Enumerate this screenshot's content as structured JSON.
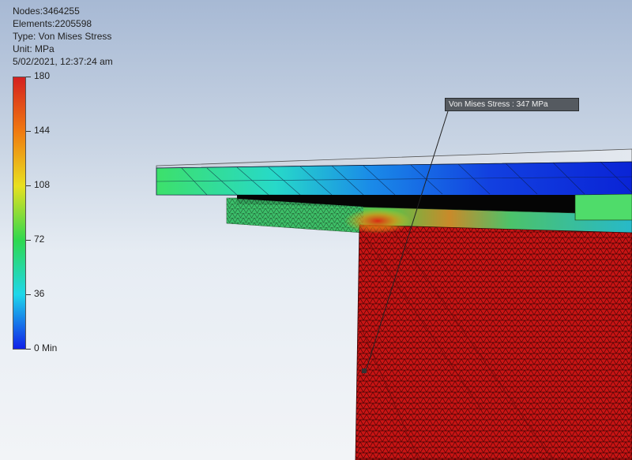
{
  "info": {
    "nodes": "Nodes:3464255",
    "elements": "Elements:2205598",
    "type": "Type: Von Mises Stress",
    "unit": "Unit: MPa",
    "timestamp": "5/02/2021, 12:37:24 am"
  },
  "legend": {
    "labels": [
      "180",
      "144",
      "108",
      "72",
      "36",
      "0 Min"
    ],
    "colors": [
      "#d42020",
      "#f07a10",
      "#e8e020",
      "#2fd84f",
      "#1fd7ea",
      "#1020e8"
    ]
  },
  "probe": {
    "label": "Von Mises Stress : 347 MPa"
  },
  "colors": {
    "max_stress": "#c81414",
    "mid_stress": "#33d166",
    "low_stress": "#1838e0",
    "background_top": "#a7b9d4",
    "background_bottom": "#f2f4f7"
  }
}
